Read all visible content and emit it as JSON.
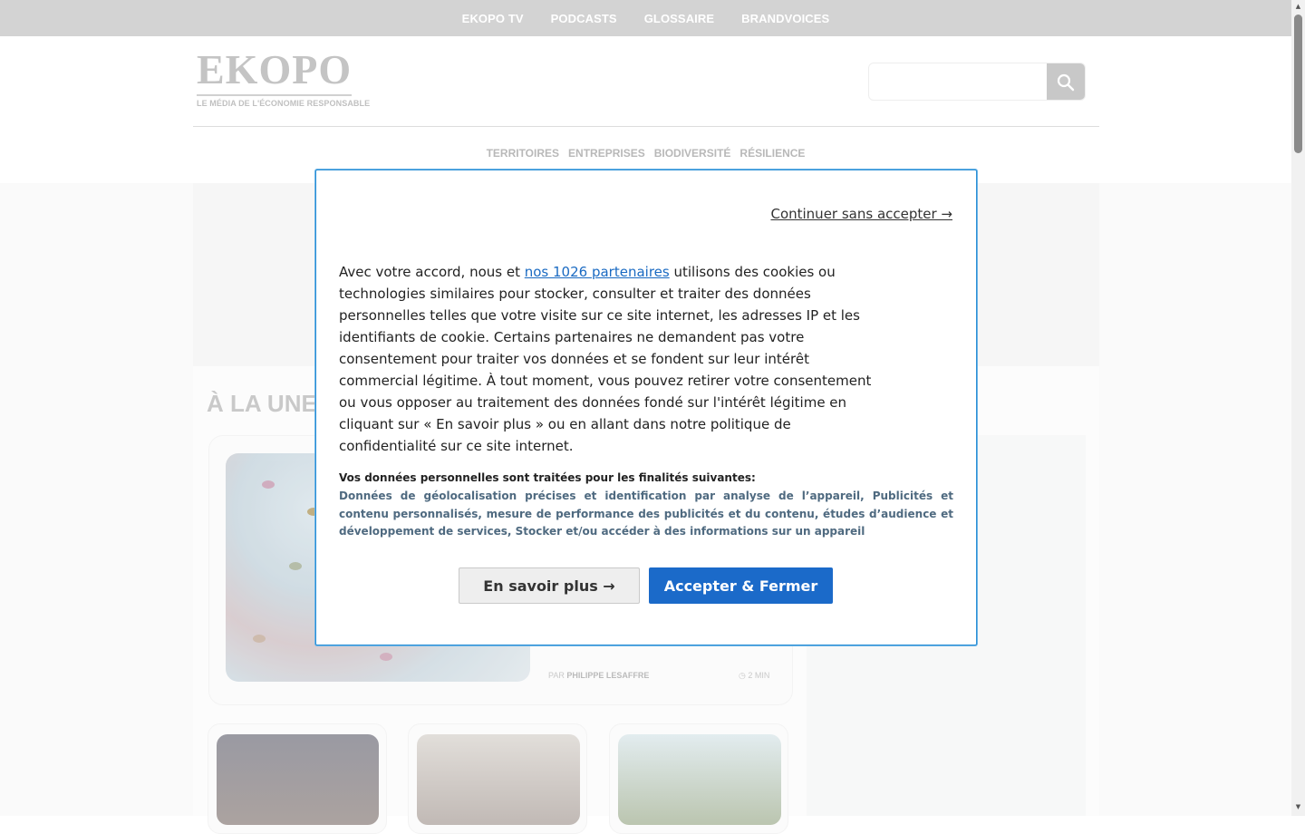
{
  "topnav": {
    "items": [
      "EKOPO TV",
      "PODCASTS",
      "GLOSSAIRE",
      "BRANDVOICES"
    ]
  },
  "header": {
    "logo_word": "EKOPO",
    "logo_tagline": "LE MÉDIA DE L'ÉCONOMIE RESPONSABLE",
    "search_placeholder": "",
    "search_icon": "search-icon"
  },
  "catnav": {
    "items": [
      "TERRITOIRES",
      "ENTREPRISES",
      "BIODIVERSITÉ",
      "RÉSILIENCE"
    ]
  },
  "main": {
    "section_title": "À LA UNE",
    "feature": {
      "byline_prefix": "PAR",
      "author": "PHILIPPE LESAFFRE",
      "read_time": "2 MIN"
    }
  },
  "consent": {
    "continue_label": "Continuer sans accepter →",
    "text_before_link": "Avec votre accord, nous et ",
    "partners_link": "nos 1026 partenaires",
    "text_after_link": " utilisons des cookies ou technologies similaires pour stocker, consulter et traiter des données personnelles telles que votre visite sur ce site internet, les adresses IP et les identifiants de cookie. Certains partenaires ne demandent pas votre consentement pour traiter vos données et se fondent sur leur intérêt commercial légitime. À tout moment, vous pouvez retirer votre consentement ou vous opposer au traitement des données fondé sur l'intérêt légitime en cliquant sur « En savoir plus » ou en allant dans notre politique de confidentialité sur ce site internet.",
    "purposes_title": "Vos données personnelles sont traitées pour les finalités suivantes:",
    "purposes": "Données de géolocalisation précises et identification par analyse de l’appareil, Publicités et contenu personnalisés, mesure de performance des publicités et du contenu, études d’audience et développement de services, Stocker et/ou accéder à des informations sur un appareil",
    "more_button": "En savoir plus →",
    "accept_button": "Accepter & Fermer"
  },
  "colors": {
    "topbar": "#d3d3d3",
    "accent_blue": "#1b6ac9",
    "modal_border": "#2b8fd6"
  }
}
